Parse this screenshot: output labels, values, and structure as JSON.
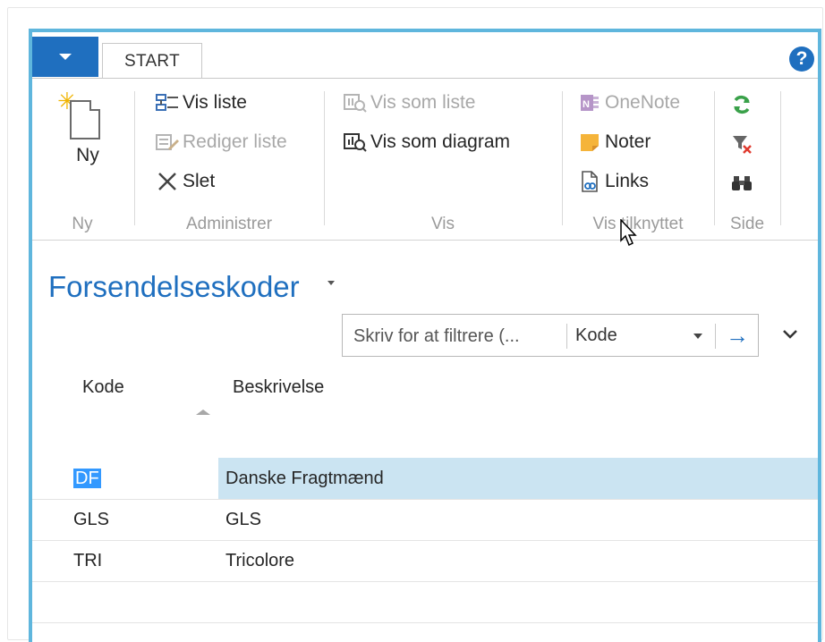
{
  "app": {
    "menu_button": "app-menu",
    "help_symbol": "?"
  },
  "tabs": [
    {
      "label": "START"
    }
  ],
  "ribbon": {
    "ny": {
      "button": "Ny",
      "group": "Ny"
    },
    "administrer": {
      "vis_liste": "Vis liste",
      "rediger_liste": "Rediger liste",
      "slet": "Slet",
      "group": "Administrer"
    },
    "vis": {
      "vis_som_liste": "Vis som liste",
      "vis_som_diagram": "Vis som diagram",
      "group": "Vis"
    },
    "vis_tilknyttet": {
      "onenote": "OneNote",
      "noter": "Noter",
      "links": "Links",
      "group": "Vis tilknyttet"
    },
    "side": {
      "group": "Side"
    }
  },
  "page": {
    "title": "Forsendelseskoder"
  },
  "filter": {
    "placeholder": "Skriv for at filtrere (...",
    "field": "Kode",
    "go_symbol": "→"
  },
  "table": {
    "headers": {
      "kode": "Kode",
      "beskrivelse": "Beskrivelse"
    },
    "rows": [
      {
        "kode": "DF",
        "beskrivelse": "Danske Fragtmænd",
        "selected": true
      },
      {
        "kode": "GLS",
        "beskrivelse": "GLS"
      },
      {
        "kode": "TRI",
        "beskrivelse": "Tricolore"
      }
    ]
  },
  "colors": {
    "accent": "#1f6fbf",
    "frame": "#5fb6dd",
    "selected_row": "#cbe4f2"
  }
}
